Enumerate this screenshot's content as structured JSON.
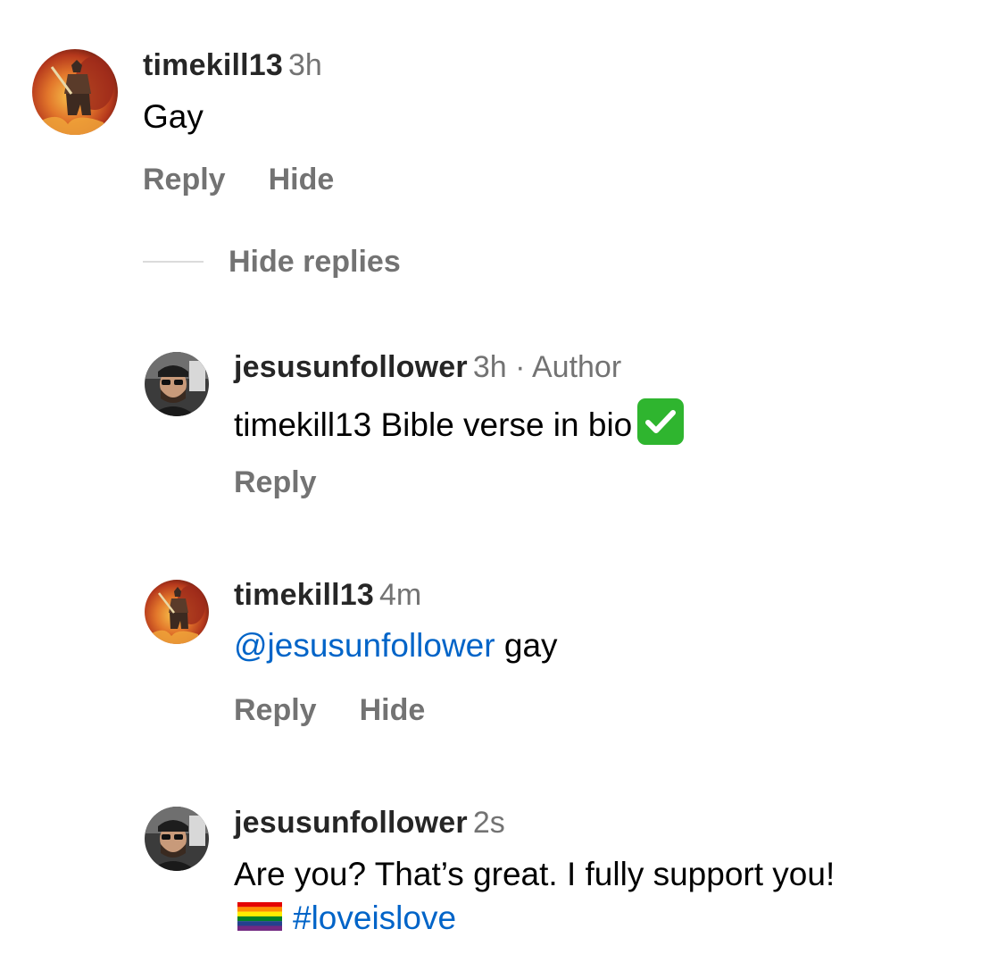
{
  "comments": [
    {
      "username": "timekill13",
      "meta": "3h",
      "text": "Gay",
      "actions": [
        "Reply",
        "Hide"
      ]
    }
  ],
  "hide_replies_label": "Hide replies",
  "replies": [
    {
      "username": "jesusunfollower",
      "meta": "3h · Author",
      "text": "timekill13 Bible verse in bio",
      "emoji": "check-mark-button-emoji",
      "actions": [
        "Reply"
      ]
    },
    {
      "username": "timekill13",
      "meta": "4m",
      "mention": "@jesusunfollower",
      "text": " gay",
      "actions": [
        "Reply",
        "Hide"
      ]
    },
    {
      "username": "jesusunfollower",
      "meta": "2s",
      "text_line1": "Are you? That’s great. I fully support you!",
      "emoji": "rainbow-flag-emoji",
      "hashtag": "#loveislove"
    }
  ],
  "colors": {
    "username": "#262626",
    "meta": "#737373",
    "link": "#0064c8",
    "divider": "#dbdbdb"
  }
}
